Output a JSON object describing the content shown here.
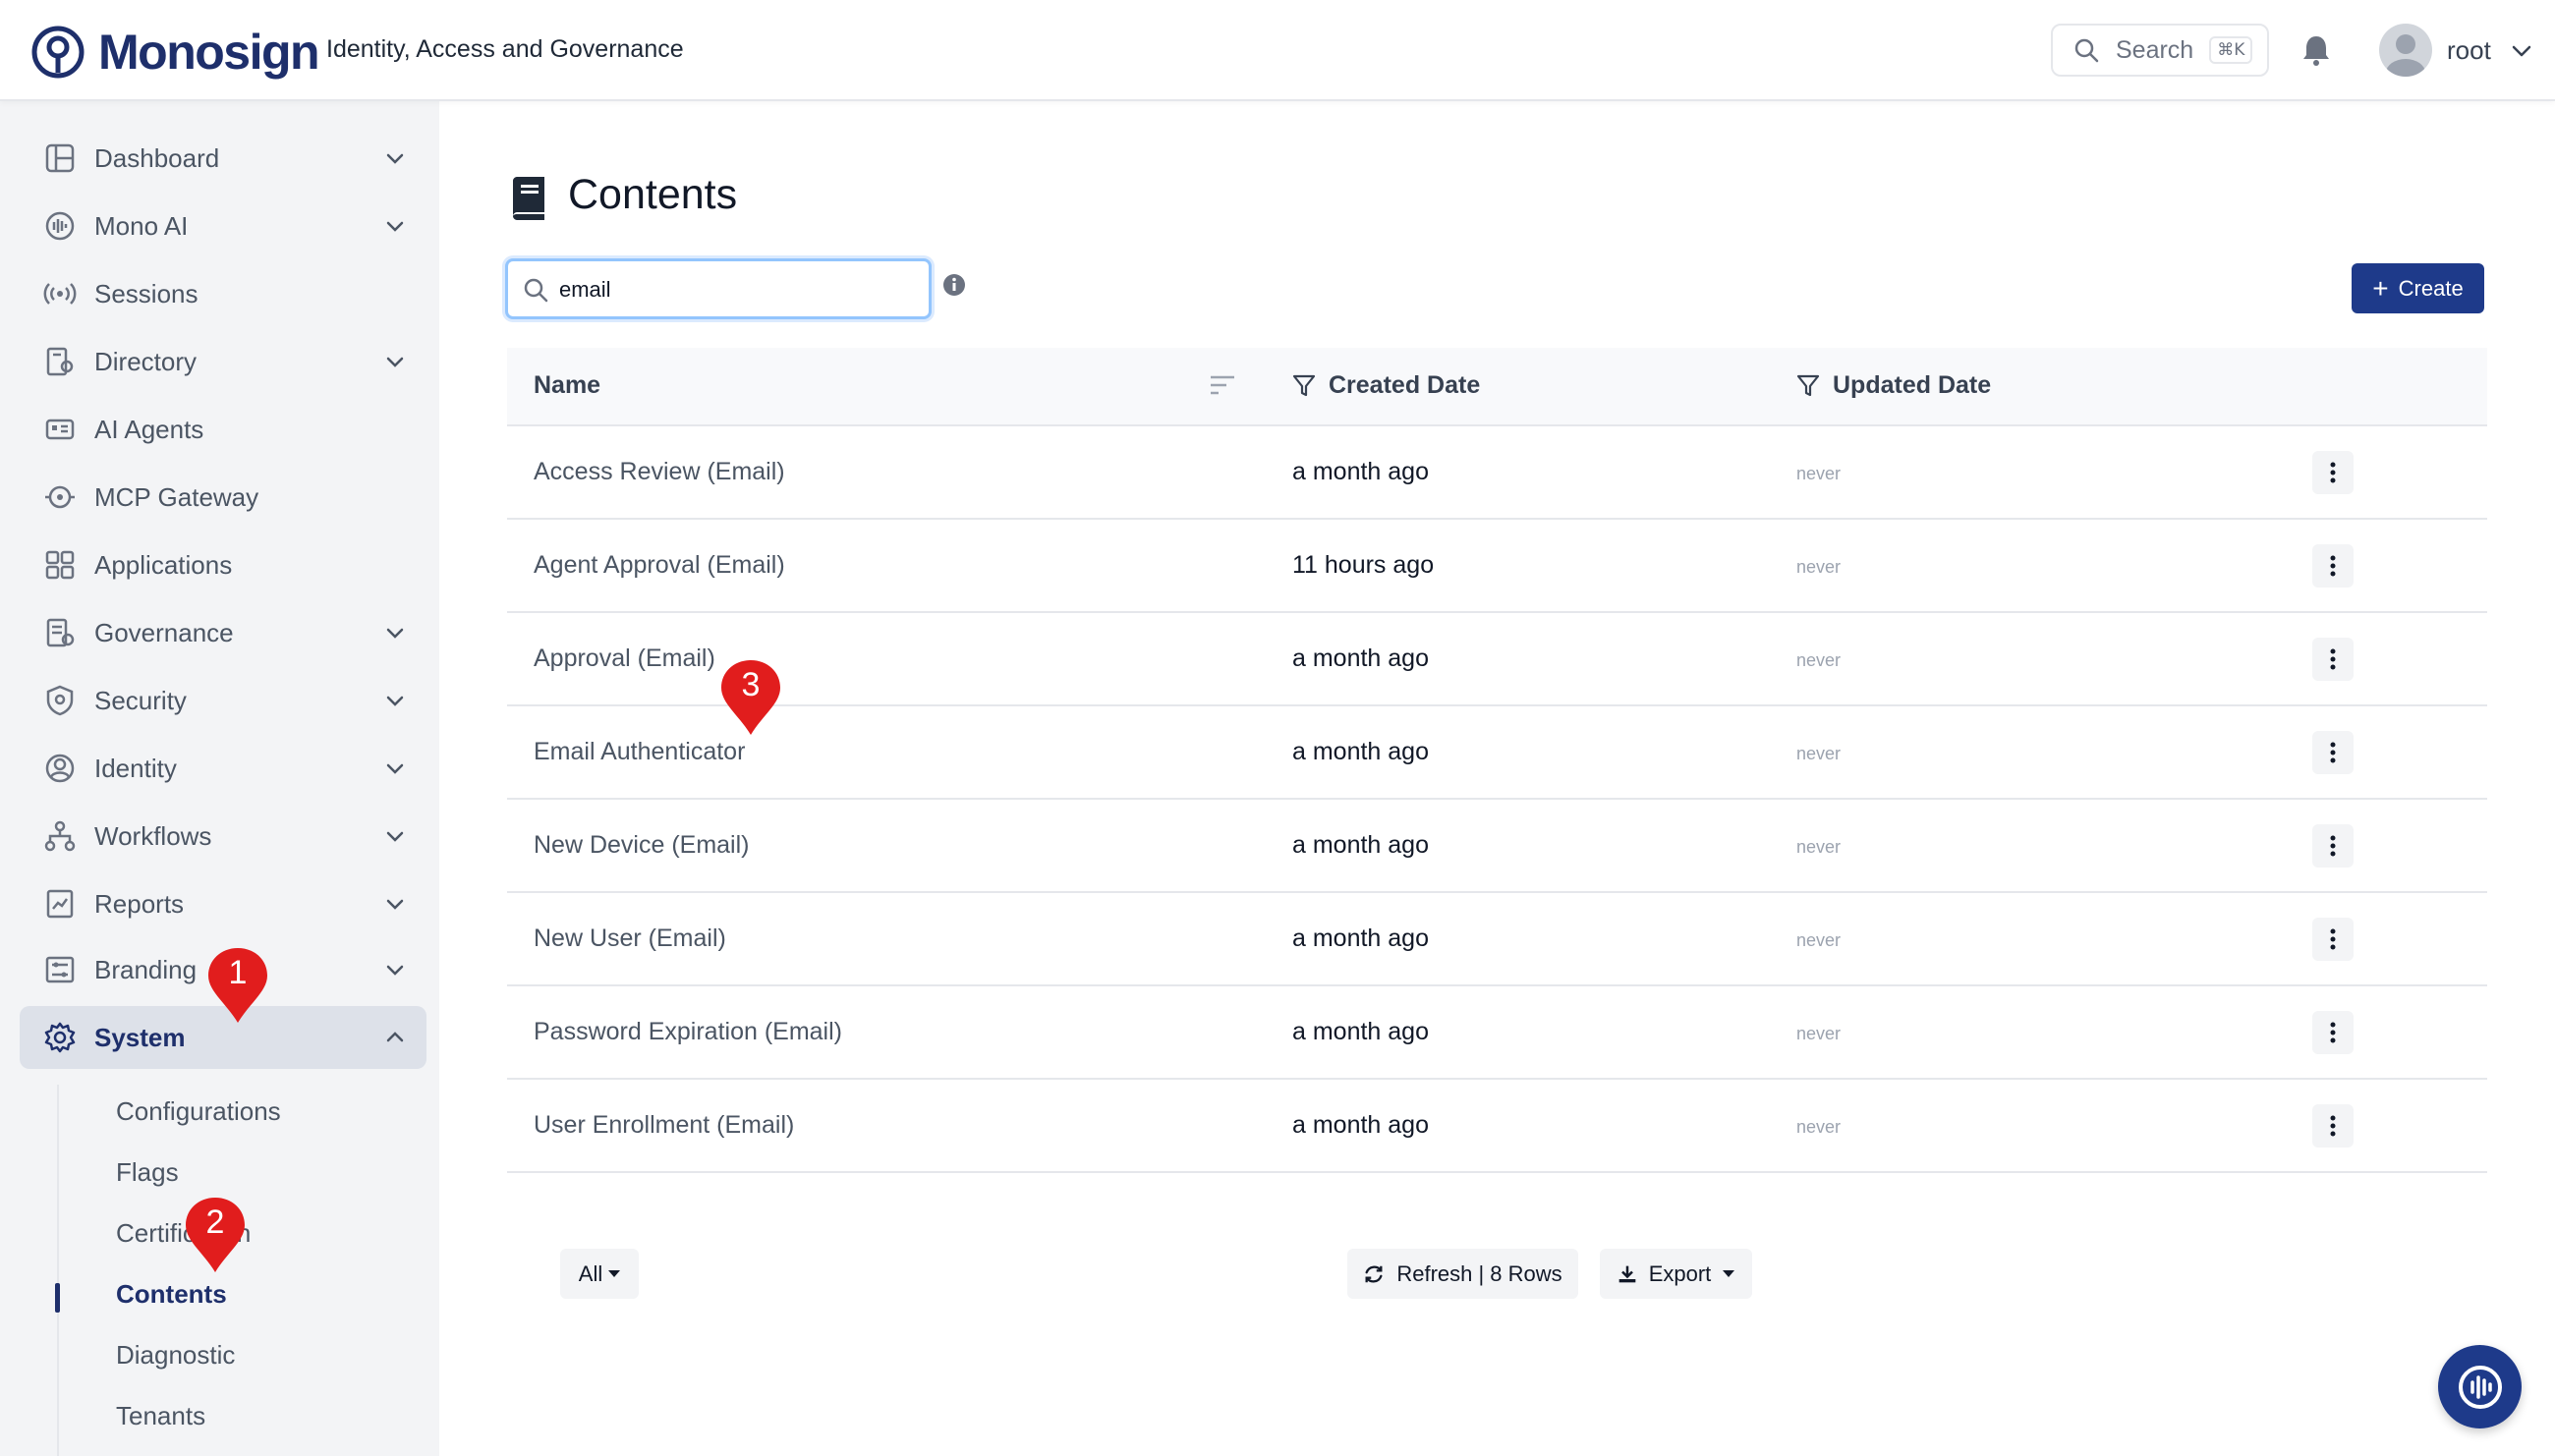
{
  "header": {
    "brand": "Monosign",
    "tagline": "Identity, Access and Governance",
    "search_label": "Search",
    "search_shortcut": "⌘K",
    "user_name": "root"
  },
  "sidebar": {
    "items": [
      {
        "label": "Dashboard",
        "icon": "dashboard-icon",
        "expandable": true
      },
      {
        "label": "Mono AI",
        "icon": "mono-ai-icon",
        "expandable": true
      },
      {
        "label": "Sessions",
        "icon": "sessions-icon",
        "expandable": false
      },
      {
        "label": "Directory",
        "icon": "directory-icon",
        "expandable": true
      },
      {
        "label": "AI Agents",
        "icon": "ai-agents-icon",
        "expandable": false
      },
      {
        "label": "MCP Gateway",
        "icon": "mcp-gateway-icon",
        "expandable": false
      },
      {
        "label": "Applications",
        "icon": "applications-icon",
        "expandable": false
      },
      {
        "label": "Governance",
        "icon": "governance-icon",
        "expandable": true
      },
      {
        "label": "Security",
        "icon": "security-icon",
        "expandable": true
      },
      {
        "label": "Identity",
        "icon": "identity-icon",
        "expandable": true
      },
      {
        "label": "Workflows",
        "icon": "workflows-icon",
        "expandable": true
      },
      {
        "label": "Reports",
        "icon": "reports-icon",
        "expandable": true
      },
      {
        "label": "Branding",
        "icon": "branding-icon",
        "expandable": true
      },
      {
        "label": "System",
        "icon": "gear-icon",
        "expandable": true,
        "active": true
      }
    ],
    "sub_items": [
      {
        "label": "Configurations"
      },
      {
        "label": "Flags"
      },
      {
        "label": "Certification"
      },
      {
        "label": "Contents",
        "active": true
      },
      {
        "label": "Diagnostic"
      },
      {
        "label": "Tenants"
      }
    ]
  },
  "main": {
    "title": "Contents",
    "search_value": "email",
    "create_label": "Create",
    "columns": {
      "name": "Name",
      "created": "Created Date",
      "updated": "Updated Date"
    },
    "rows": [
      {
        "name": "Access Review (Email)",
        "created": "a month ago",
        "updated": "never"
      },
      {
        "name": "Agent Approval (Email)",
        "created": "11 hours ago",
        "updated": "never"
      },
      {
        "name": "Approval (Email)",
        "created": "a month ago",
        "updated": "never"
      },
      {
        "name": "Email Authenticator",
        "created": "a month ago",
        "updated": "never"
      },
      {
        "name": "New Device (Email)",
        "created": "a month ago",
        "updated": "never"
      },
      {
        "name": "New User (Email)",
        "created": "a month ago",
        "updated": "never"
      },
      {
        "name": "Password Expiration (Email)",
        "created": "a month ago",
        "updated": "never"
      },
      {
        "name": "User Enrollment (Email)",
        "created": "a month ago",
        "updated": "never"
      }
    ],
    "footer": {
      "page_size": "All",
      "refresh_label": "Refresh | 8 Rows",
      "export_label": "Export"
    }
  },
  "markers": [
    {
      "number": "1"
    },
    {
      "number": "2"
    },
    {
      "number": "3"
    }
  ],
  "colors": {
    "brand": "#1e2f6b",
    "primary_button": "#1e3a8a",
    "marker": "#e11d1d",
    "sidebar_bg": "#f3f4f6"
  }
}
